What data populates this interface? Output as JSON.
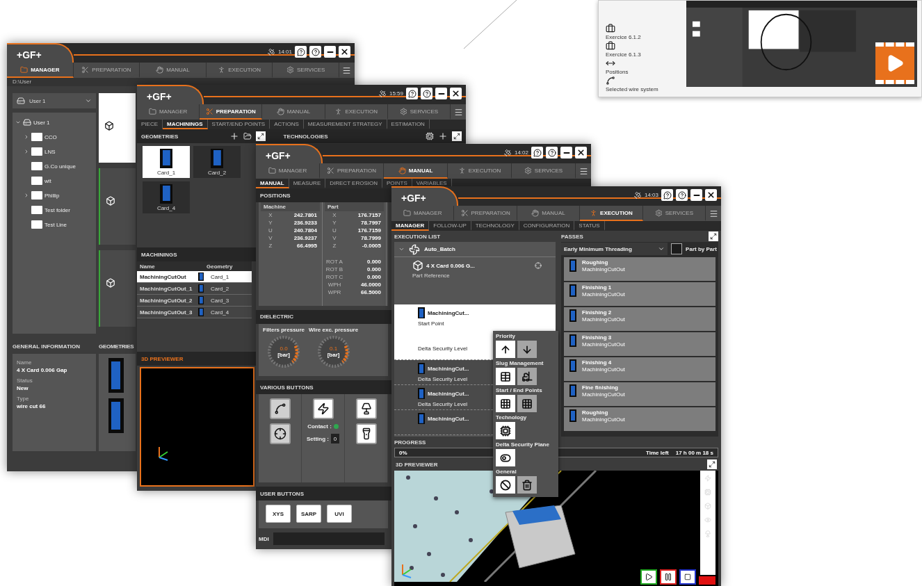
{
  "video_thumbnail": {
    "items": [
      {
        "label": "Exercice 6.1.2"
      },
      {
        "label": "Exercice 6.1.3"
      },
      {
        "label": "Positions"
      },
      {
        "label": "Selected wire system"
      }
    ]
  },
  "manager_window": {
    "header": {
      "logo": "+GF+",
      "time": "14:01",
      "tabs": [
        {
          "label": "MANAGER",
          "selected": true
        },
        {
          "label": "PREPARATION",
          "selected": false
        },
        {
          "label": "MANUAL",
          "selected": false
        },
        {
          "label": "EXECUTION",
          "selected": false
        },
        {
          "label": "SERVICES",
          "selected": false
        }
      ]
    },
    "path": "D:\\User",
    "user_select": "User 1",
    "tree": [
      {
        "label": "User 1",
        "expanded": true,
        "children": [
          {
            "label": "CCO",
            "expandable": true
          },
          {
            "label": "LNS",
            "expandable": true
          },
          {
            "label": "G.Co unique",
            "expandable": false
          },
          {
            "label": "wit",
            "expandable": false
          },
          {
            "label": "Phillip",
            "expandable": true
          },
          {
            "label": "Test folder",
            "expandable": false
          },
          {
            "label": "Test Line",
            "expandable": false
          }
        ]
      }
    ],
    "general_information": {
      "title": "GENERAL INFORMATION",
      "fields": [
        {
          "label": "Name",
          "value": "4 X Card 0.006 Gap"
        },
        {
          "label": "Status",
          "value": "New"
        },
        {
          "label": "Type",
          "value": "wire cut 66"
        }
      ]
    },
    "geometries_title": "GEOMETRIES"
  },
  "preparation_window": {
    "header": {
      "logo": "+GF+",
      "time": "15:59",
      "tabs": [
        {
          "label": "MANAGER",
          "selected": false
        },
        {
          "label": "PREPARATION",
          "selected": true
        },
        {
          "label": "MANUAL",
          "selected": false
        },
        {
          "label": "EXECUTION",
          "selected": false
        },
        {
          "label": "SERVICES",
          "selected": false
        }
      ]
    },
    "subtabs": [
      {
        "label": "PIECE",
        "selected": false
      },
      {
        "label": "MACHININGS",
        "selected": true
      },
      {
        "label": "START/END POINTS",
        "selected": false
      },
      {
        "label": "ACTIONS",
        "selected": false
      },
      {
        "label": "MEASUREMENT STRATEGY",
        "selected": false
      },
      {
        "label": "ESTIMATION",
        "selected": false
      }
    ],
    "geometries": {
      "title": "GEOMETRIES",
      "items": [
        {
          "label": "Card_1",
          "selected": true
        },
        {
          "label": "Card_2",
          "selected": false
        },
        {
          "label": "Card_4",
          "selected": false
        }
      ]
    },
    "technologies_title": "TECHNOLOGIES",
    "machinings": {
      "title": "MACHININGS",
      "columns": [
        "Name",
        "Geometry"
      ],
      "rows": [
        {
          "name": "MachiningCutOut",
          "geometry": "Card_1",
          "selected": true
        },
        {
          "name": "MachiningCutOut_1",
          "geometry": "Card_2",
          "selected": false
        },
        {
          "name": "MachiningCutOut_2",
          "geometry": "Card_3",
          "selected": false
        },
        {
          "name": "MachiningCutOut_3",
          "geometry": "Card_4",
          "selected": false
        }
      ]
    },
    "previewer_title": "3D PREVIEWER"
  },
  "manual_window": {
    "header": {
      "logo": "+GF+",
      "time": "14:02",
      "tabs": [
        {
          "label": "MANAGER",
          "selected": false
        },
        {
          "label": "PREPARATION",
          "selected": false
        },
        {
          "label": "MANUAL",
          "selected": true
        },
        {
          "label": "EXECUTION",
          "selected": false
        },
        {
          "label": "SERVICES",
          "selected": false
        }
      ]
    },
    "subtabs": [
      {
        "label": "MANUAL",
        "selected": true
      },
      {
        "label": "MEASURE",
        "selected": false
      },
      {
        "label": "DIRECT EROSION",
        "selected": false
      },
      {
        "label": "POINTS",
        "selected": false
      },
      {
        "label": "VARIABLES",
        "selected": false
      }
    ],
    "positions": {
      "title": "POSITIONS",
      "columns": [
        "Machine",
        "Part"
      ],
      "machine": [
        {
          "axis": "X",
          "value": "242.7801"
        },
        {
          "axis": "Y",
          "value": "236.9233"
        },
        {
          "axis": "U",
          "value": "240.7804"
        },
        {
          "axis": "V",
          "value": "236.9237"
        },
        {
          "axis": "Z",
          "value": "66.4995"
        }
      ],
      "part": [
        {
          "axis": "X",
          "value": "176.7157"
        },
        {
          "axis": "Y",
          "value": "78.7997"
        },
        {
          "axis": "U",
          "value": "176.7159"
        },
        {
          "axis": "V",
          "value": "78.7999"
        },
        {
          "axis": "Z",
          "value": "-0.0005"
        }
      ],
      "extra": [
        {
          "label": "ROT A",
          "value": "0.000"
        },
        {
          "label": "ROT B",
          "value": "0.000"
        },
        {
          "label": "ROT C",
          "value": "0.000"
        },
        {
          "label": "WPH",
          "value": "46.0000"
        },
        {
          "label": "WPR",
          "value": "66.5000"
        }
      ]
    },
    "dielectric": {
      "title": "DIELECTRIC",
      "gauges": [
        {
          "label": "Filters pressure",
          "value": "0.0",
          "unit": "[bar]"
        },
        {
          "label": "Wire exc. pressure",
          "value": "0.1",
          "unit": "[bar]"
        }
      ]
    },
    "various_buttons": {
      "title": "VARIOUS BUTTONS",
      "indicators": [
        {
          "label": "Contact :",
          "color": "#2fa84f"
        }
      ],
      "setting_label": "Setting :",
      "setting_value": "0"
    },
    "user_buttons": {
      "title": "USER BUTTONS",
      "buttons": [
        "XYS",
        "SARP",
        "UVI"
      ]
    },
    "mdi_label": "MDI"
  },
  "execution_window": {
    "header": {
      "logo": "+GF+",
      "time": "14:03",
      "tabs": [
        {
          "label": "MANAGER",
          "selected": false
        },
        {
          "label": "PREPARATION",
          "selected": false
        },
        {
          "label": "MANUAL",
          "selected": false
        },
        {
          "label": "EXECUTION",
          "selected": true
        },
        {
          "label": "SERVICES",
          "selected": false
        }
      ]
    },
    "subtabs": [
      {
        "label": "MANAGER",
        "selected": true
      },
      {
        "label": "FOLLOW-UP",
        "selected": false
      },
      {
        "label": "TECHNOLOGY",
        "selected": false
      },
      {
        "label": "CONFIGURATION",
        "selected": false
      },
      {
        "label": "STATUS",
        "selected": false
      }
    ],
    "execution_list": {
      "title": "EXECUTION LIST",
      "batch": "Auto_Batch",
      "part_name": "4 X Card 0.006 G...",
      "part_reference": "Part Reference",
      "items": [
        {
          "name": "MachiningCut...",
          "detail": "Start Point",
          "note": "Delta Security Level",
          "selected": true
        },
        {
          "name": "MachiningCut...",
          "note": "Delta Security Level",
          "selected": false
        },
        {
          "name": "MachiningCut...",
          "note": "Delta Security Level",
          "selected": false
        },
        {
          "name": "MachiningCut...",
          "selected": false
        }
      ]
    },
    "context_menu": {
      "sections": [
        {
          "title": "Priority",
          "actions": [
            {
              "enabled": true
            },
            {
              "enabled": false
            }
          ]
        },
        {
          "title": "Slug Management",
          "actions": [
            {
              "enabled": true
            },
            {
              "enabled": false
            }
          ]
        },
        {
          "title": "Start / End Points",
          "actions": [
            {
              "enabled": true
            },
            {
              "enabled": false
            }
          ]
        },
        {
          "title": "Technology",
          "actions": [
            {
              "enabled": true
            }
          ]
        },
        {
          "title": "Delta Security Plane",
          "actions": [
            {
              "enabled": true
            }
          ]
        },
        {
          "title": "General",
          "actions": [
            {
              "enabled": true
            },
            {
              "enabled": false
            }
          ]
        }
      ]
    },
    "passes": {
      "title": "PASSES",
      "strategy": "Early Minimum Threading",
      "part_by_part": {
        "label": "Part by Part",
        "checked": false
      },
      "items": [
        {
          "name": "Roughing",
          "machining": "MachiningCutOut"
        },
        {
          "name": "Finishing 1",
          "machining": "MachiningCutOut"
        },
        {
          "name": "Finishing 2",
          "machining": "MachiningCutOut"
        },
        {
          "name": "Finishing 3",
          "machining": "MachiningCutOut"
        },
        {
          "name": "Finishing 4",
          "machining": "MachiningCutOut"
        },
        {
          "name": "Fine finishing",
          "machining": "MachiningCutOut"
        },
        {
          "name": "Roughing",
          "machining": "MachiningCutOut"
        }
      ]
    },
    "progress": {
      "title": "PROGRESS",
      "level": 0,
      "percent": "0%",
      "time_left_label": "Time left",
      "time_left": "17 h 00 m 18 s"
    },
    "previewer_title": "3D PREVIEWER"
  }
}
